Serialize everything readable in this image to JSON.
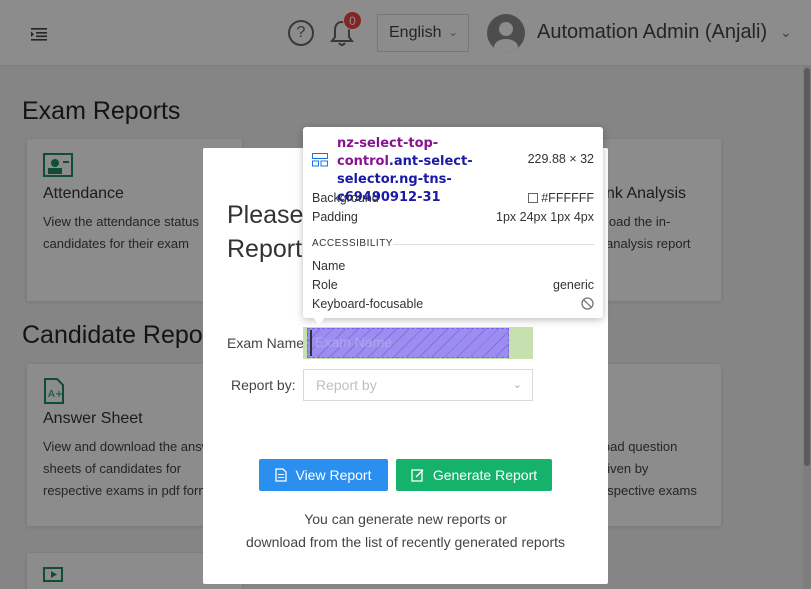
{
  "header": {
    "language": "English",
    "notification_count": "0",
    "user_name": "Automation Admin (Anjali)"
  },
  "sections": {
    "exam_reports_title": "Exam Reports",
    "candidate_reports_title": "Candidate Repo"
  },
  "cards": {
    "attendance": {
      "title": "Attendance",
      "desc_line1": "View the attendance status of",
      "desc_line2": "candidates for their exam"
    },
    "rank_analysis": {
      "title": "nk Analysis",
      "desc_line1": "load the in-",
      "desc_line2": "analysis report"
    },
    "answer_sheet": {
      "title": "Answer Sheet",
      "desc_line1": "View and download the answ",
      "desc_line2": "sheets of candidates for",
      "desc_line3": "respective exams in pdf form"
    },
    "question_log": {
      "title": "g",
      "desc_line1": "load question",
      "desc_line2": "given by",
      "desc_line3": "espective exams"
    }
  },
  "modal": {
    "title_line1": "Please",
    "title_line2": "Report",
    "exam_name_label": "Exam Name",
    "exam_name_placeholder": "Exam Name",
    "report_by_label": "Report by:",
    "report_by_placeholder": "Report by",
    "view_report_label": "View Report",
    "generate_report_label": "Generate Report",
    "hint_line1": "You can generate new reports or",
    "hint_line2": "download from the list of recently generated reports"
  },
  "devtools_tooltip": {
    "selector_tag": "nz-select-top-control",
    "selector_classes": ".ant-select-selector.ng-tns-c69490912-31",
    "dimensions": "229.88 × 32",
    "background_label": "Background",
    "background_value": "#FFFFFF",
    "padding_label": "Padding",
    "padding_value": "1px 24px 1px 4px",
    "accessibility_heading": "ACCESSIBILITY",
    "name_label": "Name",
    "role_label": "Role",
    "role_value": "generic",
    "keyboard_label": "Keyboard-focusable"
  },
  "colors": {
    "primary_button": "#2a8fee",
    "success_button": "#14b26a",
    "badge": "#ef4444",
    "card_icon": "#1c8f5e"
  }
}
